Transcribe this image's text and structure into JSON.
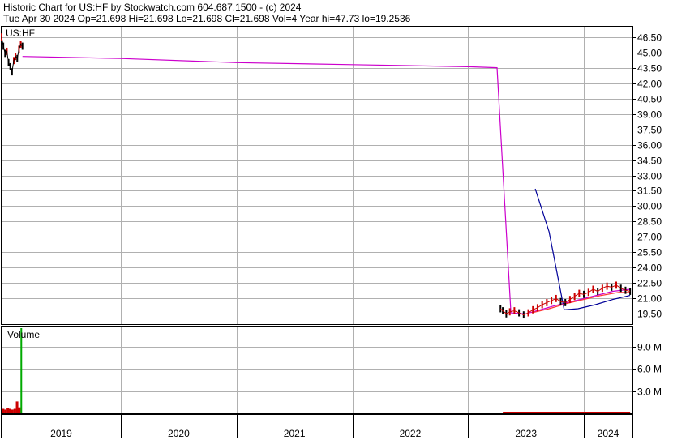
{
  "header": {
    "line1": "Historic Chart for US:HF by Stockwatch.com 604.687.1500 - (c) 2024",
    "line2": "Tue Apr 30 2024   Op=21.698   Hi=21.698   Lo=21.698   Cl=21.698   Vol=4   Year hi=47.73   lo=19.2536"
  },
  "chart_data": [
    {
      "type": "line",
      "title": "US:HF",
      "ylim": [
        18.5,
        47.5
      ],
      "y_ticks": [
        46.5,
        45.0,
        43.5,
        42.0,
        40.5,
        39.0,
        37.5,
        36.0,
        34.5,
        33.0,
        31.5,
        30.0,
        28.5,
        27.0,
        25.5,
        24.0,
        22.5,
        21.0,
        19.5
      ],
      "y_tick_labels": [
        "46.50",
        "45.00",
        "43.50",
        "42.00",
        "40.50",
        "39.00",
        "37.50",
        "36.00",
        "34.50",
        "33.00",
        "31.50",
        "30.00",
        "28.50",
        "27.00",
        "25.50",
        "24.00",
        "22.50",
        "21.00",
        "19.50"
      ],
      "xlim": [
        2018.97,
        2024.42
      ],
      "x_ticks": [
        2019.0,
        2020.0,
        2021.0,
        2022.0,
        2023.0,
        2024.0
      ],
      "x_tick_labels": [
        "2019",
        "2020",
        "2021",
        "2022",
        "2023",
        "2024"
      ],
      "grid": true,
      "colors": {
        "price": "#000000",
        "up_tick": "#cc0000",
        "ma_long": "#cc00cc",
        "ma_short": "#000099",
        "ma_medium": "#ff3333"
      },
      "series": [
        {
          "role": "price",
          "x": [
            2018.97,
            2018.985,
            2019.0,
            2019.015,
            2019.03,
            2019.045,
            2019.06,
            2019.075,
            2019.09,
            2019.105,
            2019.12,
            2019.135,
            2019.15,
            2023.28,
            2023.3,
            2023.33,
            2023.36,
            2023.4,
            2023.44,
            2023.48,
            2023.52,
            2023.56,
            2023.6,
            2023.64,
            2023.68,
            2023.72,
            2023.76,
            2023.8,
            2023.84,
            2023.88,
            2023.92,
            2023.96,
            2024.0,
            2024.04,
            2024.08,
            2024.12,
            2024.16,
            2024.2,
            2024.24,
            2024.28,
            2024.32,
            2024.36,
            2024.4
          ],
          "values": [
            46.5,
            45.6,
            44.9,
            45.1,
            44.0,
            43.6,
            43.1,
            44.2,
            44.6,
            44.4,
            45.3,
            45.8,
            45.6,
            20.0,
            19.8,
            19.5,
            19.7,
            19.8,
            19.6,
            19.4,
            19.6,
            19.9,
            20.1,
            20.4,
            20.6,
            20.8,
            21.0,
            20.7,
            20.6,
            20.9,
            21.2,
            21.5,
            21.4,
            21.6,
            21.9,
            21.7,
            22.0,
            22.2,
            22.1,
            22.3,
            22.0,
            21.8,
            21.7
          ]
        },
        {
          "role": "ma_long",
          "x": [
            2019.15,
            2020.0,
            2021.0,
            2022.0,
            2023.0,
            2023.25,
            2023.37,
            2023.5,
            2023.75,
            2024.0,
            2024.25,
            2024.4
          ],
          "values": [
            44.6,
            44.4,
            44.0,
            43.8,
            43.6,
            43.5,
            19.6,
            19.5,
            20.3,
            21.0,
            21.7,
            21.9
          ]
        },
        {
          "role": "ma_short",
          "x": [
            2023.58,
            2023.7,
            2023.83,
            2023.95,
            2024.1,
            2024.25,
            2024.4
          ],
          "values": [
            31.7,
            27.5,
            19.9,
            20.0,
            20.4,
            20.9,
            21.3
          ]
        },
        {
          "role": "ma_medium",
          "x": [
            2023.55,
            2023.7,
            2023.85,
            2024.0,
            2024.15,
            2024.3,
            2024.4
          ],
          "values": [
            19.6,
            20.0,
            20.5,
            20.9,
            21.3,
            21.6,
            21.6
          ]
        }
      ]
    },
    {
      "type": "bar",
      "title": "Volume",
      "ylim": [
        0,
        11.5
      ],
      "y_ticks": [
        3.0,
        6.0,
        9.0
      ],
      "y_tick_labels": [
        "3.0 M",
        "6.0 M",
        "9.0 M"
      ],
      "colors": {
        "down": "#cc0000",
        "spike": "#00aa00"
      },
      "x": [
        2018.98,
        2019.0,
        2019.02,
        2019.04,
        2019.06,
        2019.08,
        2019.1,
        2019.12,
        2019.14
      ],
      "values": [
        0.6,
        0.5,
        0.7,
        0.6,
        0.5,
        0.6,
        1.6,
        0.8,
        11.5
      ],
      "x_recent_start": 2023.3,
      "x_recent_end": 2024.4,
      "recent_level": 0.15
    }
  ]
}
